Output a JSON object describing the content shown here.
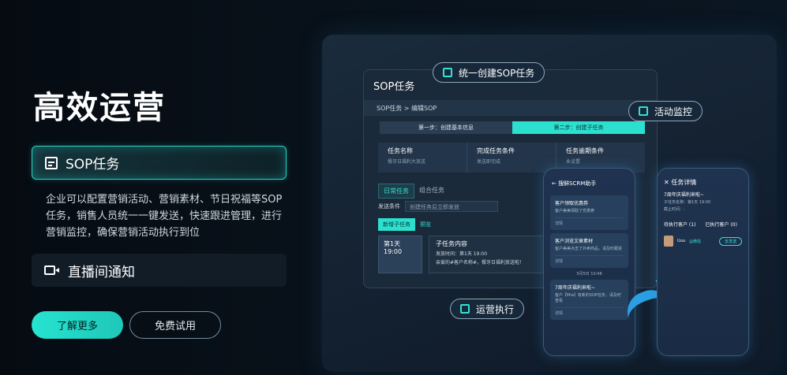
{
  "left": {
    "title": "高效运营",
    "feature_active": "SOP任务",
    "description": "企业可以配置营销活动、营销素材、节日祝福等SOP任务，销售人员统一一键发送，快速跟进管理，进行营销监控，确保营销活动执行到位",
    "feature_2": "直播间通知",
    "btn_learn": "了解更多",
    "btn_trial": "免费试用"
  },
  "showcase": {
    "pill_create": "统一创建SOP任务",
    "pill_monitor": "活动监控",
    "pill_execute": "运营执行",
    "panel": {
      "title": "SOP任务",
      "breadcrumb": "SOP任务 > 编辑SOP",
      "step1": "第一步：创建基本信息",
      "step2": "第二步：创建子任务",
      "conditions": [
        {
          "h": "任务名称",
          "s": "餐牙日福利大放送"
        },
        {
          "h": "完成任务条件",
          "s": "发送即完成"
        },
        {
          "h": "任务逾期条件",
          "s": "永设置"
        }
      ],
      "tab_daily": "日常任务",
      "tab_combo": "组合任务",
      "send_label": "发送条件",
      "send_value": "创建任务后立即发放",
      "subtab_new": "新增子任务",
      "subtab_preview": "预览",
      "day": "第1天 19:00",
      "task_title": "子任务内容",
      "task_time": "发放时间：第1天 19:00",
      "task_text": "亲爱的#客户名称#，餐牙日福利放送啦！"
    },
    "phone1": {
      "header": "← 搜鲜SCRM助手",
      "card1_h": "客户领取优惠券",
      "card1_s": "客户美美领取了优惠券",
      "card1_d": "详情",
      "card2_h": "客户浏览文章素材",
      "card2_s": "客户美美点击了外卖商品，请及时跟进",
      "card2_d": "详情",
      "date": "5月5日 10:48",
      "card3_h": "7周年庆福利来啦~",
      "card3_s": "客户【Mia】有新的SOP任务，请及时查看",
      "card3_d": "详情"
    },
    "phone2": {
      "title": "✕ 任务详情",
      "task": "7周年庆福利来啦~",
      "sub1": "子任务名称：第1天 19:00",
      "sub2": "截止时间：-",
      "tab_pending": "待执行客户 (1)",
      "tab_done": "已执行客户 (0)",
      "customer": "Uuu",
      "customer_tag": "@微信",
      "send_btn": "去发送"
    }
  }
}
